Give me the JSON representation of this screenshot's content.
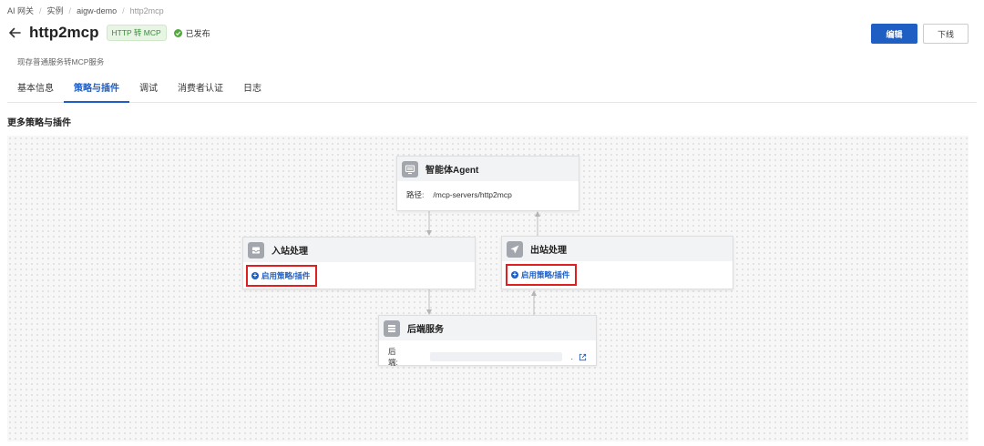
{
  "breadcrumb": [
    "AI 网关",
    "实例",
    "aigw-demo",
    "http2mcp"
  ],
  "header": {
    "title": "http2mcp",
    "badge": "HTTP 转 MCP",
    "status": "已发布",
    "subtitle": "现存普通服务转MCP服务",
    "edit_label": "编辑",
    "offline_label": "下线"
  },
  "tabs": [
    "基本信息",
    "策略与插件",
    "调试",
    "消费者认证",
    "日志"
  ],
  "active_tab": 1,
  "section_title": "更多策略与插件",
  "nodes": {
    "agent": {
      "title": "智能体Agent",
      "path_label": "路径:",
      "path_value": "/mcp-servers/http2mcp"
    },
    "inbound": {
      "title": "入站处理",
      "link": "启用策略/插件"
    },
    "outbound": {
      "title": "出站处理",
      "link": "启用策略/插件"
    },
    "backend": {
      "title": "后端服务",
      "backend_label": "后端:",
      "suffix": "."
    }
  },
  "icons": {
    "back": "arrow-left-icon",
    "status": "check-circle-icon",
    "agent": "monitor-icon",
    "inbound": "inbox-icon",
    "outbound": "send-icon",
    "backend": "list-icon",
    "external": "external-link-icon"
  },
  "colors": {
    "primary": "#1f5fc4",
    "highlight_border": "#e02020",
    "success": "#52a83c"
  }
}
